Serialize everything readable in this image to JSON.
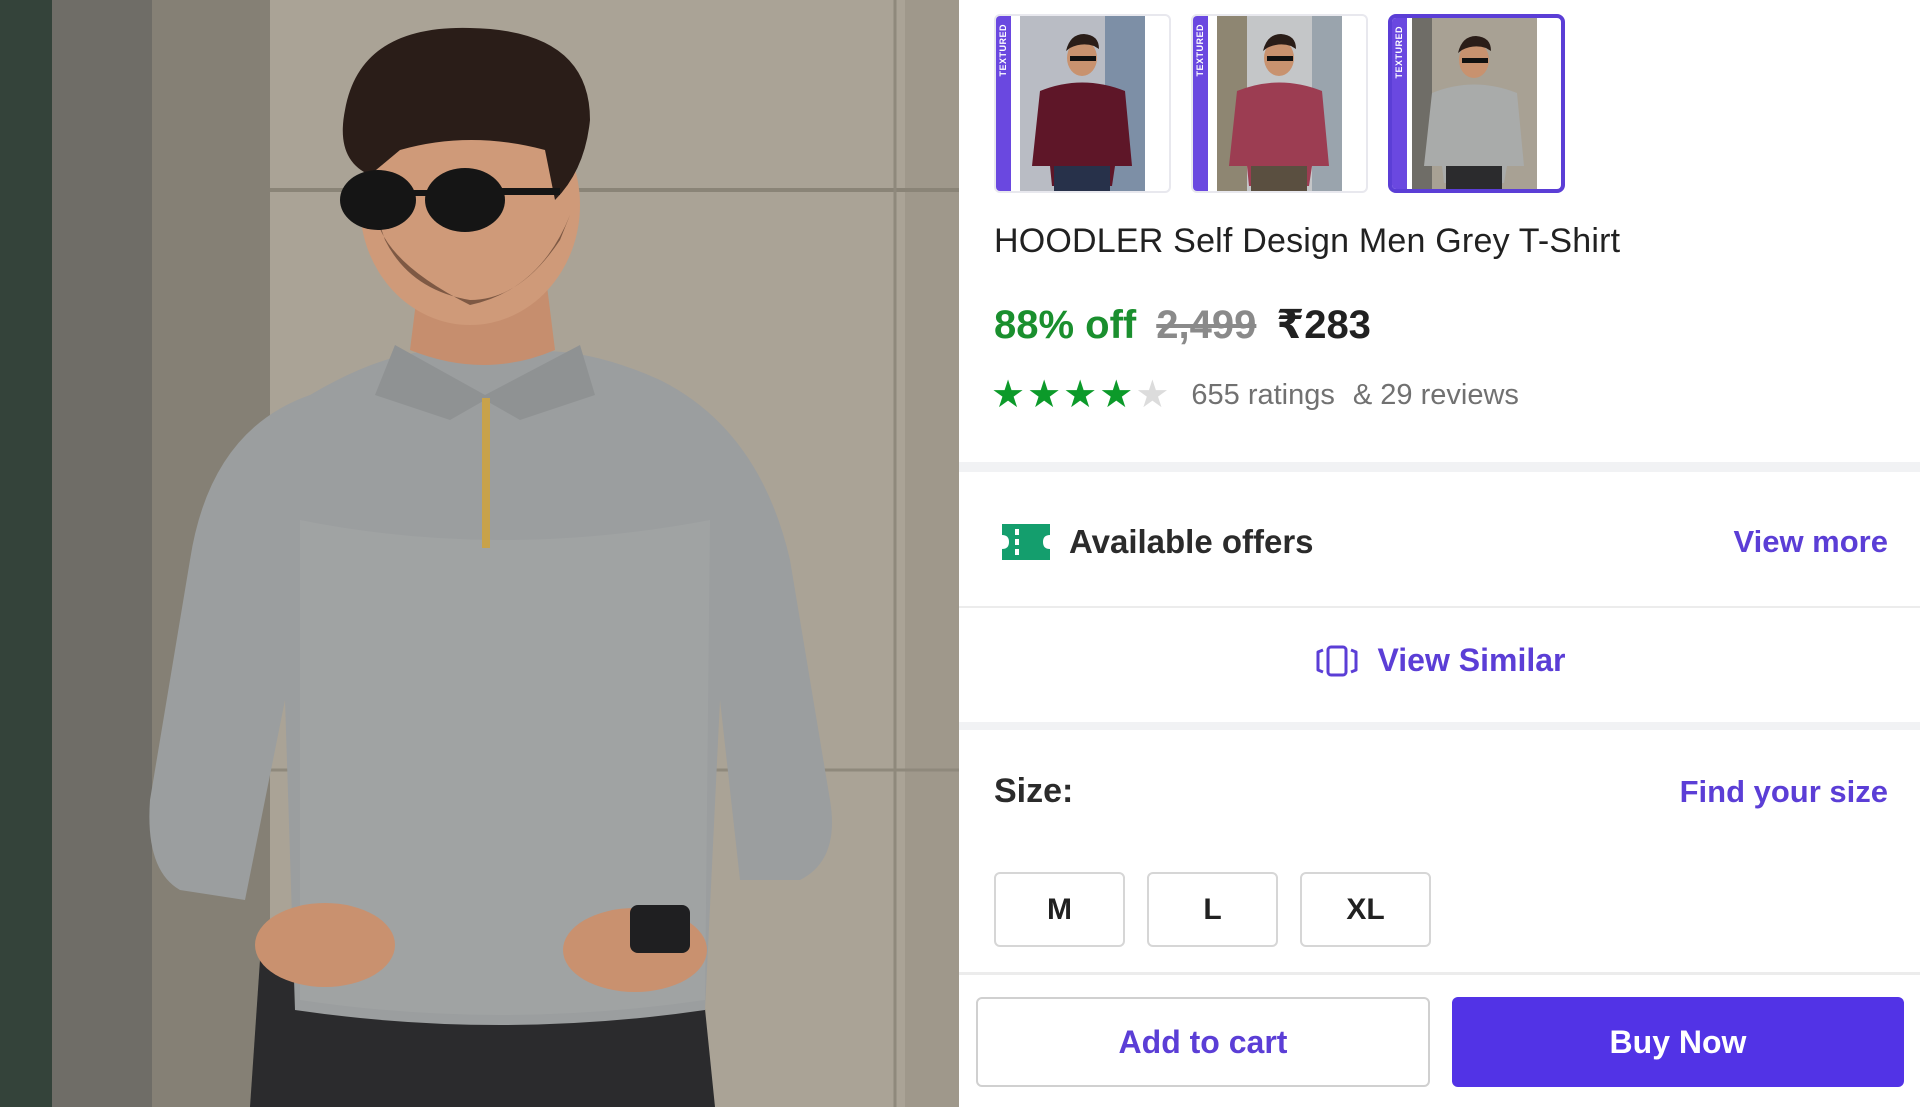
{
  "product": {
    "title": "HOODLER Self Design Men Grey T-Shirt",
    "discount": "88% off",
    "mrp": "2,499",
    "price": "₹283",
    "rating_value": 4,
    "rating_max": 5,
    "ratings_count": "655 ratings",
    "reviews_count": "& 29 reviews"
  },
  "gallery": {
    "thumbnails": [
      {
        "tag": "TEXTURED",
        "color": "#5e1628",
        "selected": false
      },
      {
        "tag": "TEXTURED",
        "color": "#9c3d52",
        "selected": false
      },
      {
        "tag": "TEXTURED",
        "color": "#a9abaa",
        "selected": true
      }
    ]
  },
  "offers": {
    "label": "Available offers",
    "link": "View more",
    "icon": "ticket-icon"
  },
  "similar": {
    "label": "View Similar",
    "icon": "view-similar-icon"
  },
  "size": {
    "label": "Size:",
    "link": "Find your size",
    "options": [
      "M",
      "L",
      "XL"
    ]
  },
  "actions": {
    "add_to_cart": "Add to cart",
    "buy_now": "Buy Now"
  },
  "colors": {
    "accent": "#5b3ed6",
    "buy_button": "#5233e6",
    "discount_green": "#1a8f2e",
    "star_green": "#0c9a2a"
  }
}
